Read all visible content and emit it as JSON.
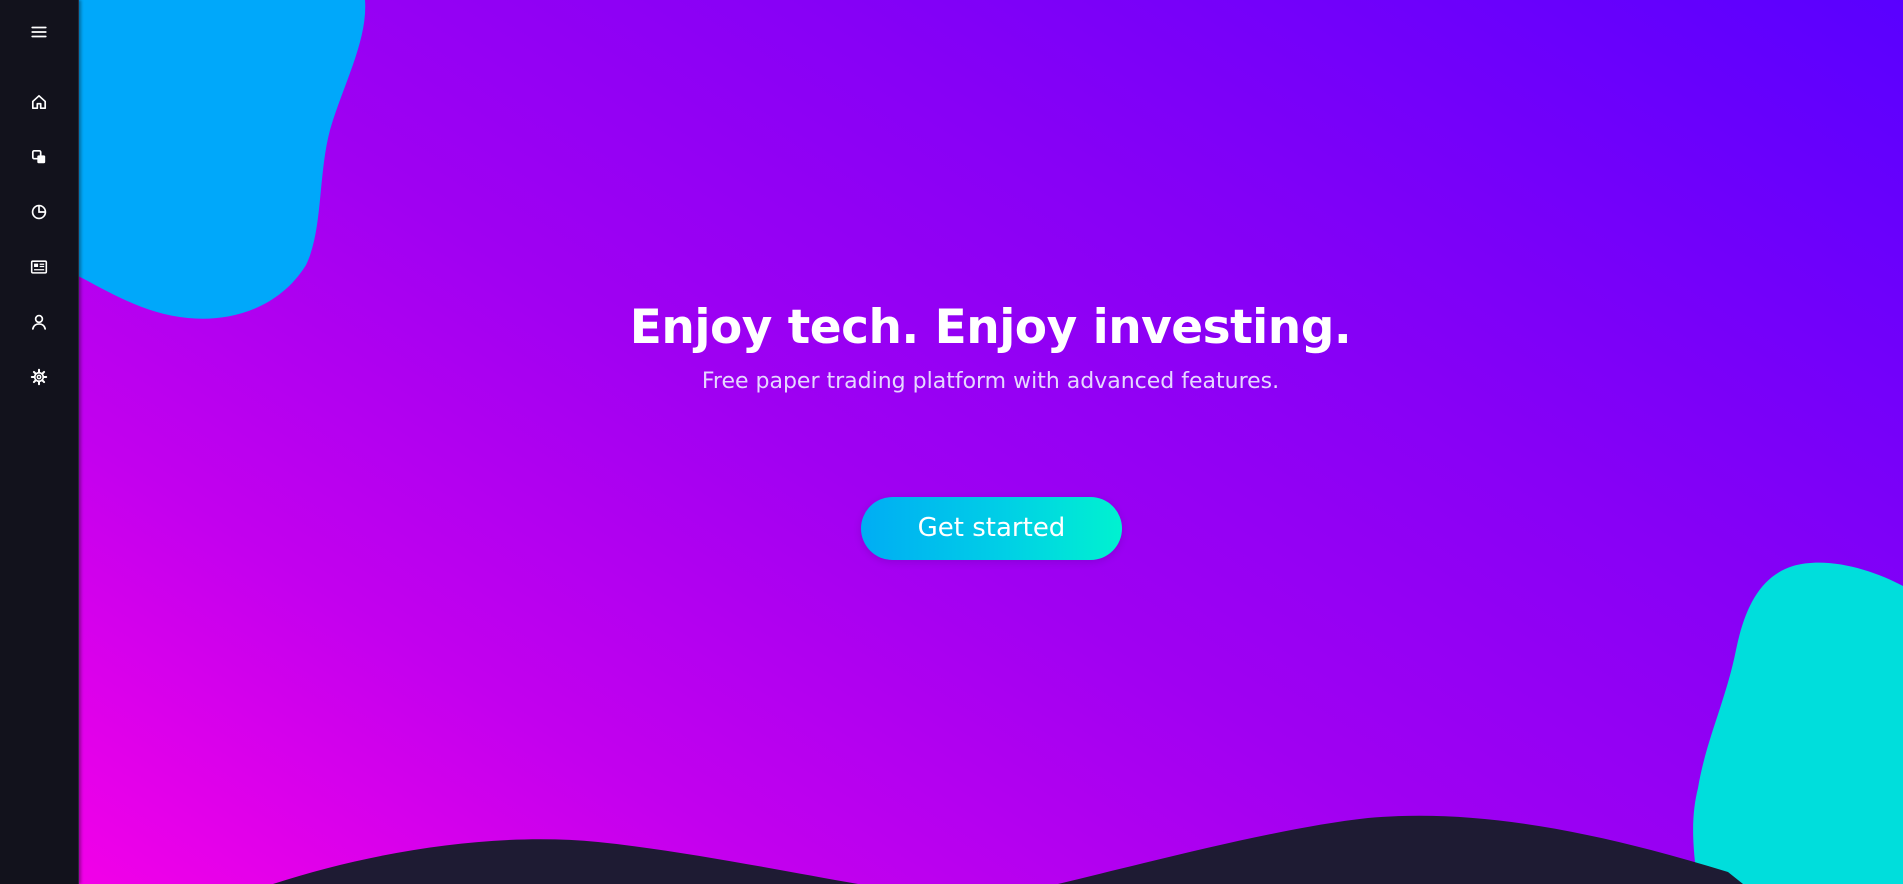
{
  "sidebar": {
    "items": [
      {
        "icon": "menu-icon"
      },
      {
        "icon": "home-icon"
      },
      {
        "icon": "layers-icon"
      },
      {
        "icon": "pie-chart-icon"
      },
      {
        "icon": "newspaper-icon"
      },
      {
        "icon": "user-icon"
      },
      {
        "icon": "settings-gear-icon"
      }
    ]
  },
  "hero": {
    "title": "Enjoy tech. Enjoy investing.",
    "subtitle": "Free paper trading platform with advanced features.",
    "cta_label": "Get started"
  },
  "colors": {
    "sidebar_bg": "#12121c",
    "gradient_start": "#f200e8",
    "gradient_end": "#5900ff",
    "blob_blue": "#00a8fa",
    "blob_teal": "#00dedc",
    "wave_dark": "#1e1b33",
    "cta_start": "#00adf4",
    "cta_end": "#00f2d0"
  }
}
